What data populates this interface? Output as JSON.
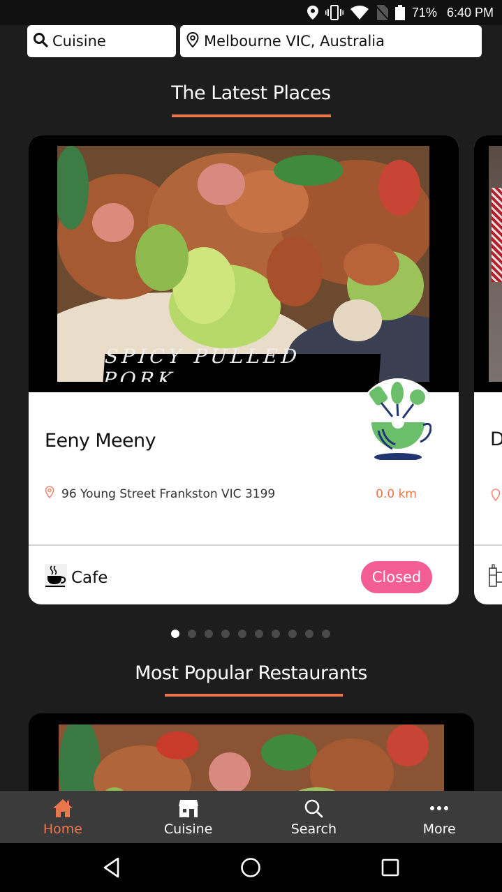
{
  "status_bar": {
    "icons": [
      "location-icon",
      "vibrate-icon",
      "wifi-icon",
      "no-sim-icon",
      "battery-icon"
    ],
    "battery": "71%",
    "time": "6:40 PM"
  },
  "search": {
    "cuisine_label": "Cuisine",
    "location_value": "Melbourne VIC, Australia"
  },
  "sections": {
    "latest_title": "The Latest Places",
    "popular_title": "Most Popular Restaurants"
  },
  "colors": {
    "accent": "#e8774e",
    "closed_badge": "#f25d94",
    "background": "#1d1d1d",
    "nav_bar": "#3b3b3b"
  },
  "latest_places": [
    {
      "image_caption": "SPICY PULLED PORK",
      "name": "Eeny Meeny",
      "address": "96 Young Street Frankston VIC 3199",
      "distance": "0.0 km",
      "category": "Cafe",
      "category_icon": "coffee-cup-icon",
      "status": "Closed"
    },
    {
      "name": "D",
      "category_icon": "building-icon"
    }
  ],
  "carousel": {
    "total_pages": 10,
    "active_page": 1
  },
  "bottom_nav": [
    {
      "label": "Home",
      "icon": "home-icon",
      "active": true
    },
    {
      "label": "Cuisine",
      "icon": "store-icon",
      "active": false
    },
    {
      "label": "Search",
      "icon": "search-icon",
      "active": false
    },
    {
      "label": "More",
      "icon": "more-dots-icon",
      "active": false
    }
  ]
}
